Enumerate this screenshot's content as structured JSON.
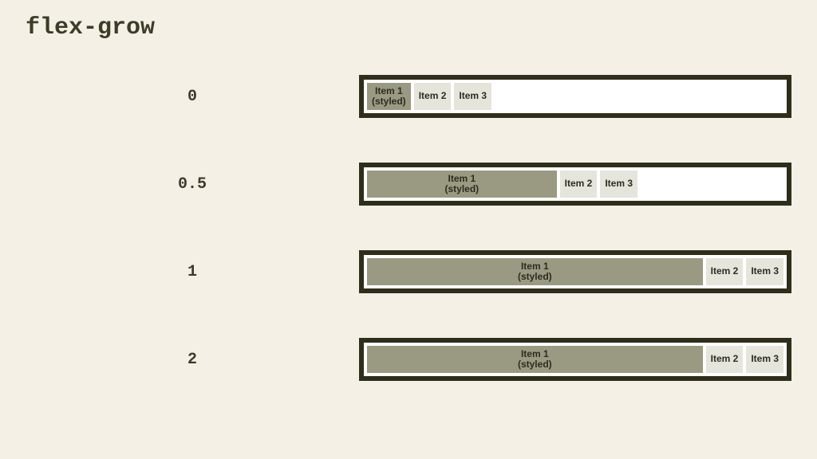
{
  "title": "flex-grow",
  "labels": {
    "item1_line1": "Item 1",
    "item1_line2": "(styled)",
    "item2": "Item 2",
    "item3": "Item 3"
  },
  "rows": [
    {
      "value": "0",
      "grow": 0
    },
    {
      "value": "0.5",
      "grow": 0.5
    },
    {
      "value": "1",
      "grow": 1
    },
    {
      "value": "2",
      "grow": 2
    }
  ]
}
